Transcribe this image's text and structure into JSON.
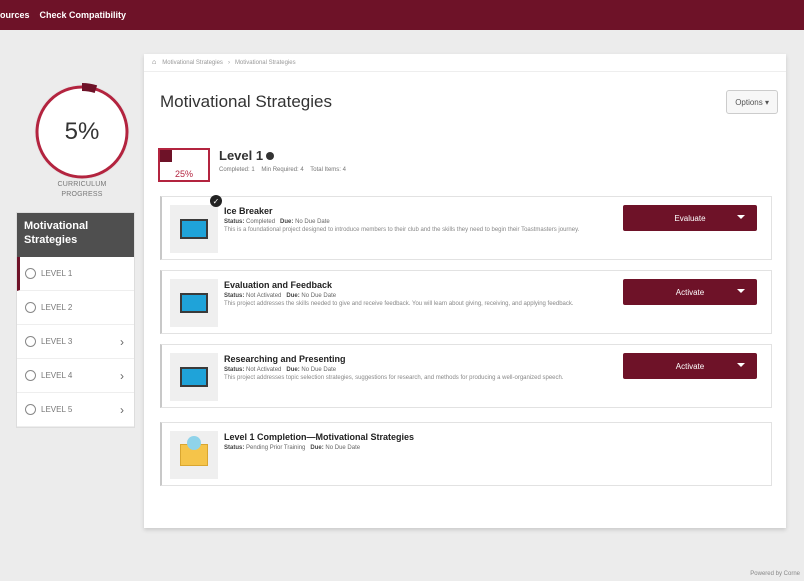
{
  "topbar": {
    "nav": [
      "ources",
      "Check Compatibility"
    ]
  },
  "progress": {
    "percent_label": "5%",
    "fraction": 0.05,
    "caption_line1": "CURRICULUM",
    "caption_line2": "PROGRESS"
  },
  "sidenav": {
    "header_line1": "Motivational",
    "header_line2": "Strategies",
    "items": [
      {
        "label": "LEVEL 1",
        "active": true,
        "chevron": false
      },
      {
        "label": "LEVEL 2",
        "active": false,
        "chevron": false
      },
      {
        "label": "LEVEL 3",
        "active": false,
        "chevron": true
      },
      {
        "label": "LEVEL 4",
        "active": false,
        "chevron": true
      },
      {
        "label": "LEVEL 5",
        "active": false,
        "chevron": true
      }
    ],
    "chevron_glyph": "›"
  },
  "breadcrumb": {
    "home_glyph": "⌂",
    "parent": "Motivational Strategies",
    "separator": "›",
    "current": "Motivational Strategies"
  },
  "main": {
    "title": "Motivational Strategies",
    "options_label": "Options ▾"
  },
  "level": {
    "title": "Level 1",
    "badge_pct": "25%",
    "badge_fraction": 0.25,
    "completed": "Completed: 1",
    "min_required": "Min Required: 4",
    "total_items": "Total Items: 4"
  },
  "projects": [
    {
      "title": "Ice Breaker",
      "status_label": "Status:",
      "status": "Completed",
      "due_label": "Due:",
      "due": "No Due Date",
      "desc": "This is a foundational project designed to introduce members to their club and the skills they need to begin their Toastmasters journey.",
      "action": "Evaluate",
      "icon": "screen-icon",
      "completed": true
    },
    {
      "title": "Evaluation and Feedback",
      "status_label": "Status:",
      "status": "Not Activated",
      "due_label": "Due:",
      "due": "No Due Date",
      "desc": "This project addresses the skills needed to give and receive feedback. You will learn about giving, receiving, and applying feedback.",
      "action": "Activate",
      "icon": "screen-icon",
      "completed": false
    },
    {
      "title": "Researching and Presenting",
      "status_label": "Status:",
      "status": "Not Activated",
      "due_label": "Due:",
      "due": "No Due Date",
      "desc": "This project addresses topic selection strategies, suggestions for research, and methods for producing a well-organized speech.",
      "action": "Activate",
      "icon": "screen-icon",
      "completed": false
    },
    {
      "title": "Level 1 Completion—Motivational Strategies",
      "status_label": "Status:",
      "status": "Pending Prior Training",
      "due_label": "Due:",
      "due": "No Due Date",
      "desc": "",
      "action": "",
      "icon": "certificate-icon",
      "completed": false
    }
  ],
  "footer": {
    "note": "Powered by Corne"
  },
  "colors": {
    "brand": "#6e1228",
    "ring": "#b3243f"
  }
}
